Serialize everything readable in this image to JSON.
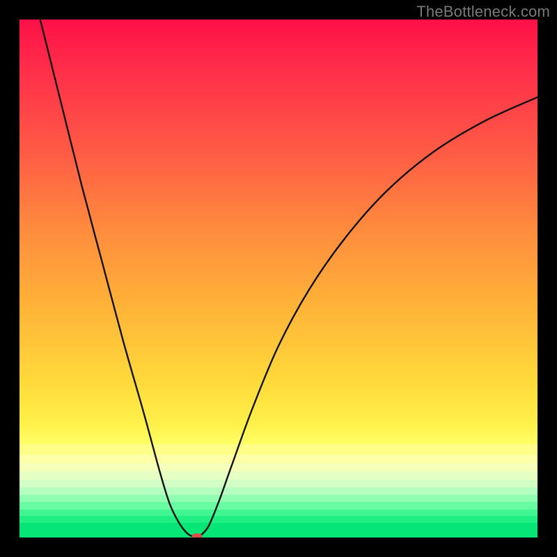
{
  "watermark": "TheBottleneck.com",
  "colors": {
    "frame": "#000000",
    "marker": "#d9524a",
    "curve": "#111111"
  },
  "bands": [
    {
      "top_pct": 82.0,
      "height_pct": 2.0,
      "color": "#fffe88"
    },
    {
      "top_pct": 84.0,
      "height_pct": 1.6,
      "color": "#feffa6"
    },
    {
      "top_pct": 85.6,
      "height_pct": 1.6,
      "color": "#f6ffba"
    },
    {
      "top_pct": 87.2,
      "height_pct": 1.6,
      "color": "#e6ffc3"
    },
    {
      "top_pct": 88.8,
      "height_pct": 1.5,
      "color": "#d2ffc4"
    },
    {
      "top_pct": 90.3,
      "height_pct": 1.5,
      "color": "#b4ffbf"
    },
    {
      "top_pct": 91.8,
      "height_pct": 1.4,
      "color": "#90feb1"
    },
    {
      "top_pct": 93.2,
      "height_pct": 1.4,
      "color": "#67fba2"
    },
    {
      "top_pct": 94.6,
      "height_pct": 1.3,
      "color": "#40f592"
    },
    {
      "top_pct": 95.9,
      "height_pct": 1.3,
      "color": "#1fee82"
    },
    {
      "top_pct": 97.2,
      "height_pct": 2.8,
      "color": "#06e676"
    }
  ],
  "chart_data": {
    "type": "line",
    "title": "",
    "xlabel": "",
    "ylabel": "",
    "xlim": [
      0,
      100
    ],
    "ylim": [
      0,
      100
    ],
    "left_branch": {
      "x": [
        4,
        8,
        12,
        16,
        20,
        24,
        27,
        29,
        31,
        32.5,
        33.5
      ],
      "y": [
        100,
        84,
        68,
        53,
        38,
        24,
        13,
        6.5,
        2.5,
        0.7,
        0.2
      ]
    },
    "right_branch": {
      "x": [
        35,
        36.5,
        38.5,
        41,
        45,
        50,
        56,
        63,
        71,
        80,
        90,
        100
      ],
      "y": [
        0.4,
        2.2,
        7,
        14,
        25,
        37,
        48,
        58,
        67,
        74.5,
        80.5,
        85
      ]
    },
    "marker": {
      "x": 34.3,
      "y": 0.12
    }
  }
}
